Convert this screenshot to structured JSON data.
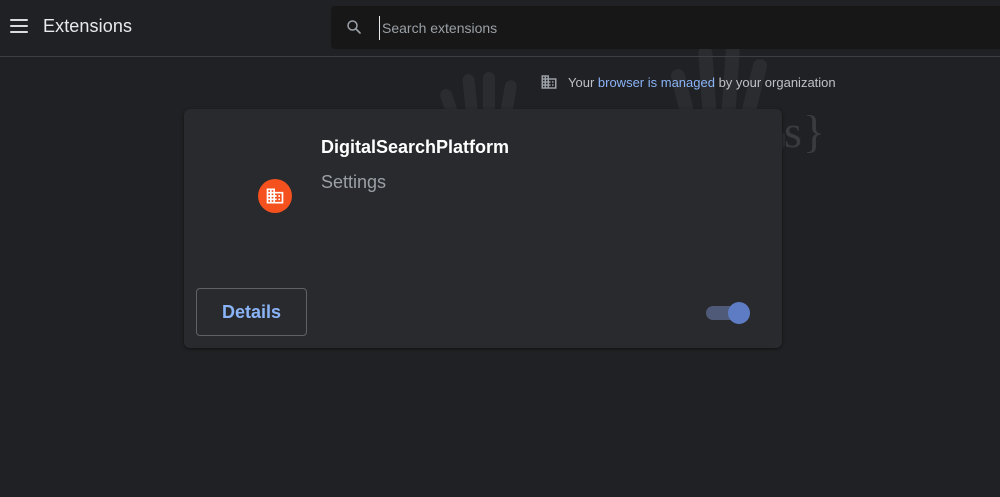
{
  "header": {
    "title": "Extensions",
    "menu_icon": "hamburger-menu-icon"
  },
  "search": {
    "placeholder": "Search extensions",
    "value": "",
    "icon": "search-icon"
  },
  "managed_notice": {
    "prefix": "Your ",
    "link": "browser is managed",
    "suffix": " by your organization",
    "icon": "building-icon"
  },
  "extension": {
    "name": "DigitalSearchPlatform",
    "description": "Settings",
    "icon": "building-icon",
    "details_label": "Details",
    "enabled": true
  },
  "watermark": {
    "text": "{malwarefixes}"
  },
  "colors": {
    "background": "#202124",
    "card": "#292a2d",
    "accent": "#8ab4f8",
    "extension_icon": "#f4511e"
  }
}
